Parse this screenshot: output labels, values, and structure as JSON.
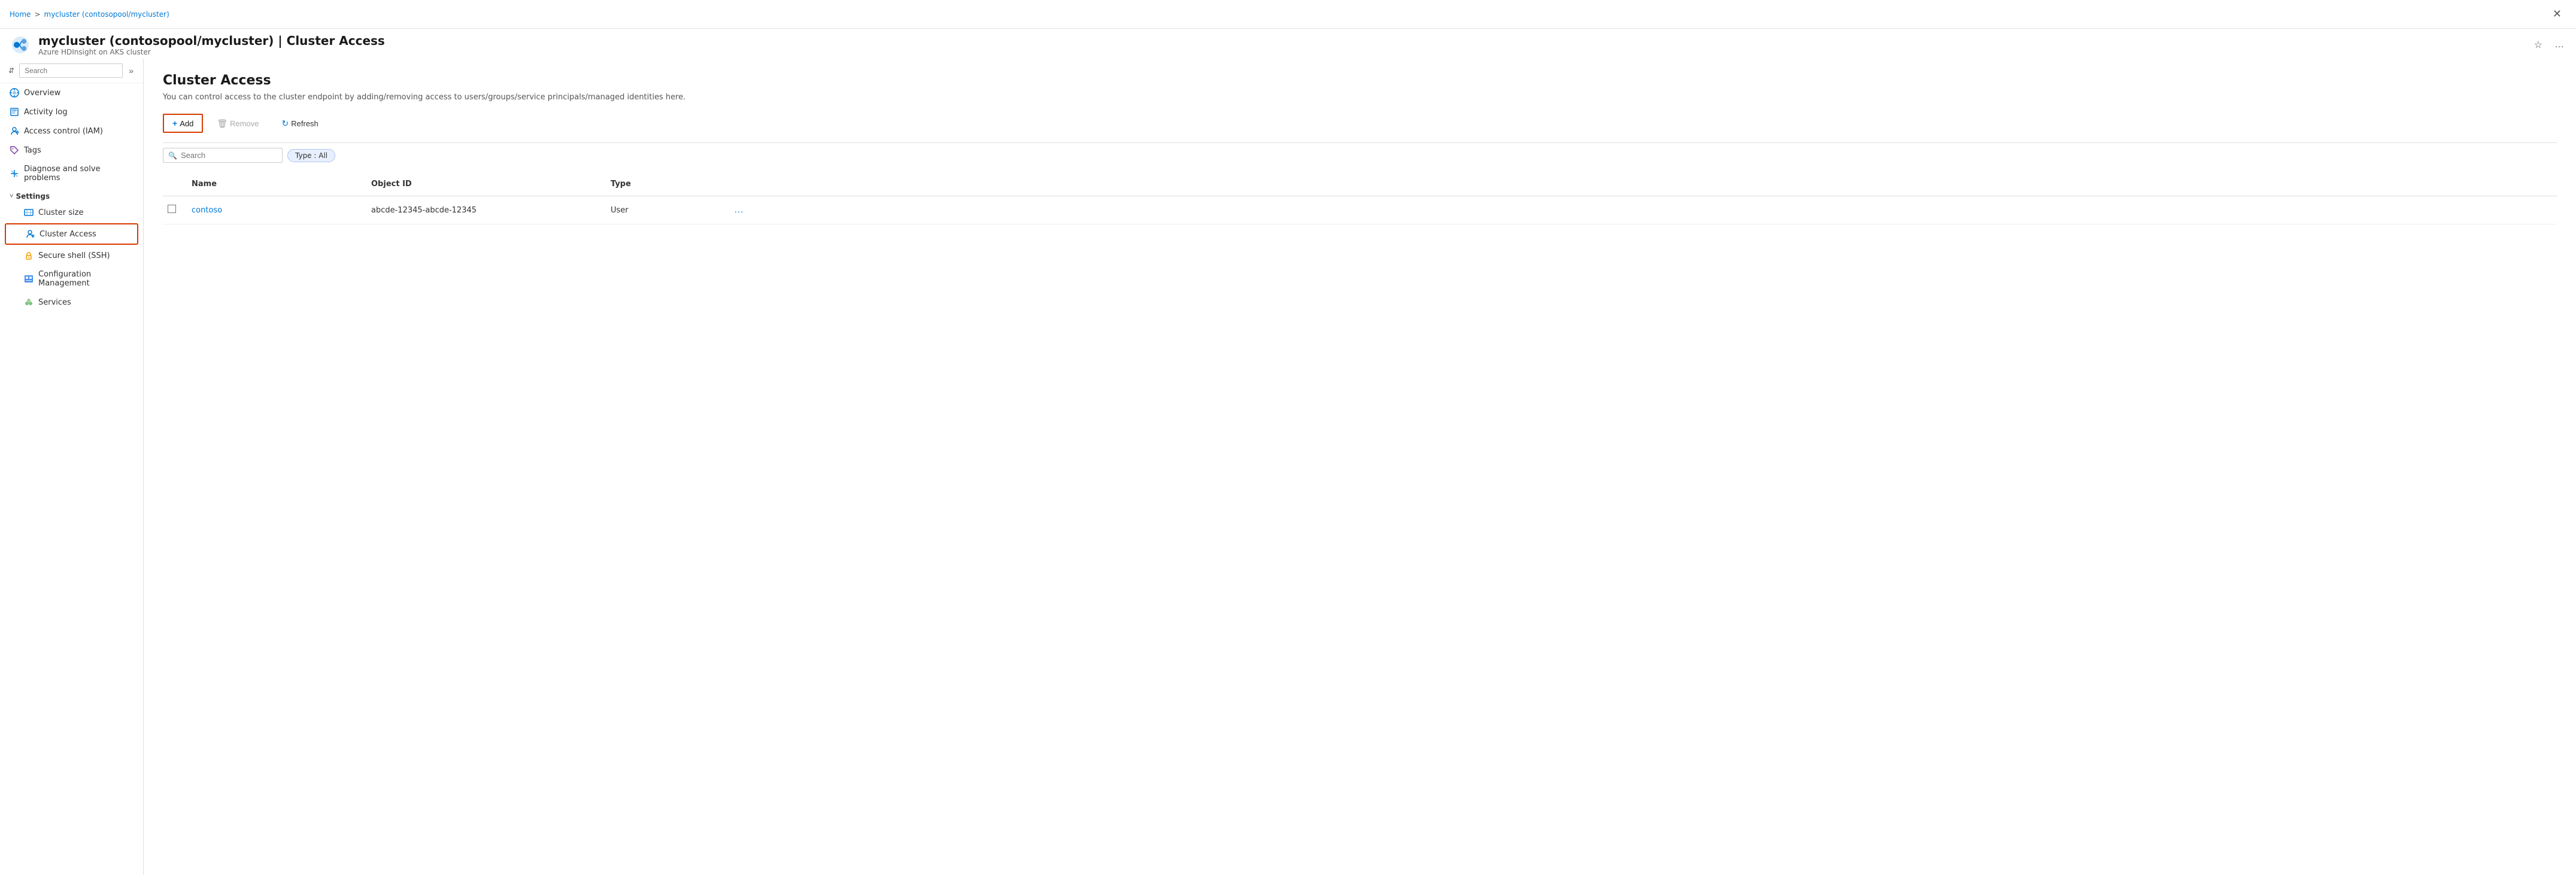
{
  "breadcrumb": {
    "home": "Home",
    "separator": ">",
    "current": "mycluster (contosopool/mycluster)"
  },
  "resource": {
    "title": "mycluster (contosopool/mycluster) | Cluster Access",
    "subtitle": "Azure HDInsight on AKS cluster",
    "icon_alt": "cluster-icon"
  },
  "sidebar": {
    "search_placeholder": "Search",
    "items": [
      {
        "id": "overview",
        "label": "Overview",
        "icon": "overview"
      },
      {
        "id": "activity-log",
        "label": "Activity log",
        "icon": "activity"
      },
      {
        "id": "access-control",
        "label": "Access control (IAM)",
        "icon": "iam"
      },
      {
        "id": "tags",
        "label": "Tags",
        "icon": "tags"
      },
      {
        "id": "diagnose",
        "label": "Diagnose and solve problems",
        "icon": "diagnose"
      }
    ],
    "sections": [
      {
        "label": "Settings",
        "items": [
          {
            "id": "cluster-size",
            "label": "Cluster size",
            "icon": "cluster-size"
          },
          {
            "id": "cluster-access",
            "label": "Cluster Access",
            "icon": "cluster-access",
            "active": true
          },
          {
            "id": "ssh",
            "label": "Secure shell (SSH)",
            "icon": "ssh"
          },
          {
            "id": "config-mgmt",
            "label": "Configuration Management",
            "icon": "config"
          },
          {
            "id": "services",
            "label": "Services",
            "icon": "services"
          }
        ]
      }
    ]
  },
  "content": {
    "title": "Cluster Access",
    "description": "You can control access to the cluster endpoint by adding/removing access to users/groups/service principals/managed identities here.",
    "toolbar": {
      "add_label": "Add",
      "remove_label": "Remove",
      "refresh_label": "Refresh"
    },
    "filter": {
      "search_placeholder": "Search",
      "type_filter": "Type : All"
    },
    "table": {
      "columns": [
        "",
        "Name",
        "Object ID",
        "Type",
        ""
      ],
      "rows": [
        {
          "name": "contoso",
          "object_id": "abcde-12345-abcde-12345",
          "type": "User"
        }
      ]
    }
  }
}
